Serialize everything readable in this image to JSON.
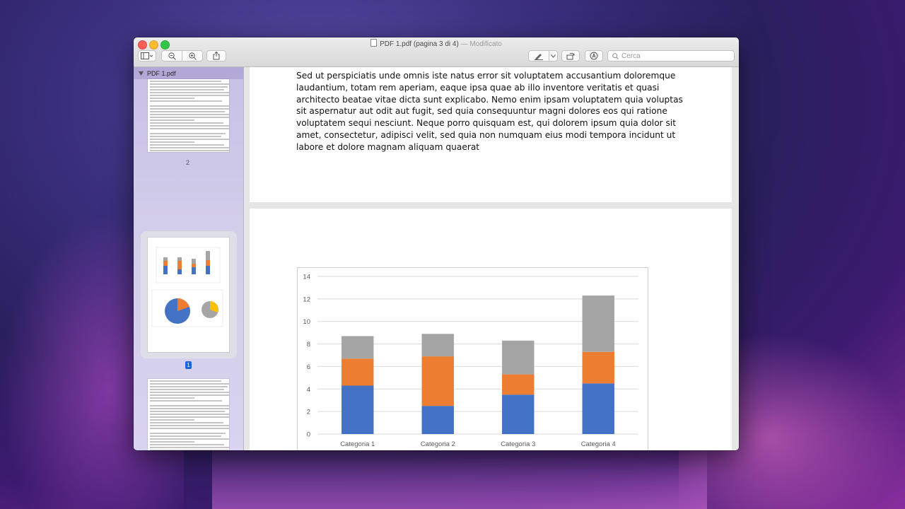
{
  "window": {
    "filename": "PDF 1.pdf (pagina 3 di 4)",
    "modified": "— Modificato"
  },
  "toolbar": {
    "search_placeholder": "Cerca"
  },
  "sidebar": {
    "document_name": "PDF 1.pdf",
    "page_labels": [
      "2",
      "1"
    ]
  },
  "page_text": "Sed ut perspiciatis unde omnis iste natus error sit voluptatem accusantium doloremque laudantium, totam rem aperiam, eaque ipsa quae ab illo inventore veritatis et quasi architecto beatae vitae dicta sunt explicabo. Nemo enim ipsam voluptatem quia voluptas sit aspernatur aut odit aut fugit, sed quia consequuntur magni dolores eos qui ratione voluptatem sequi nesciunt. Neque porro quisquam est, qui dolorem ipsum quia dolor sit amet, consectetur, adipisci velit, sed quia non numquam eius modi tempora incidunt ut labore et dolore magnam aliquam quaerat",
  "chart_data": {
    "type": "bar",
    "stacked": true,
    "categories": [
      "Categoria 1",
      "Categoria 2",
      "Categoria 3",
      "Categoria 4"
    ],
    "series": [
      {
        "values": [
          4.3,
          2.5,
          3.5,
          4.5
        ],
        "color": "#4472c4"
      },
      {
        "values": [
          2.4,
          4.4,
          1.8,
          2.8
        ],
        "color": "#ed7d31"
      },
      {
        "values": [
          2.0,
          2.0,
          3.0,
          5.0
        ],
        "color": "#a5a5a5"
      }
    ],
    "yticks": [
      0,
      2,
      4,
      6,
      8,
      10,
      12,
      14
    ],
    "ylim": [
      0,
      14
    ],
    "grid": true
  }
}
